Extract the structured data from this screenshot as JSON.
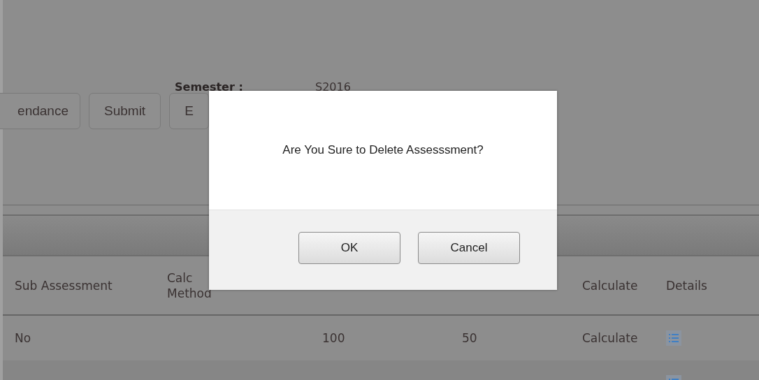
{
  "form": {
    "semester_label": "Semester :",
    "semester_value": "S2016"
  },
  "buttons": [
    "endance",
    "Submit",
    "E"
  ],
  "table": {
    "columns": [
      "Sub Assessment",
      "Calc\nMethod",
      null,
      null,
      "Calculate",
      "Details"
    ],
    "rows": [
      {
        "cells": [
          "No",
          "",
          "100",
          "50",
          "Calculate"
        ],
        "details": true
      },
      {
        "cells": [
          "",
          "",
          "",
          "",
          ""
        ],
        "details": true
      }
    ]
  },
  "dialog": {
    "message": "Are You Sure to Delete Assesssment?",
    "buttons": [
      "OK",
      "Cancel"
    ]
  }
}
